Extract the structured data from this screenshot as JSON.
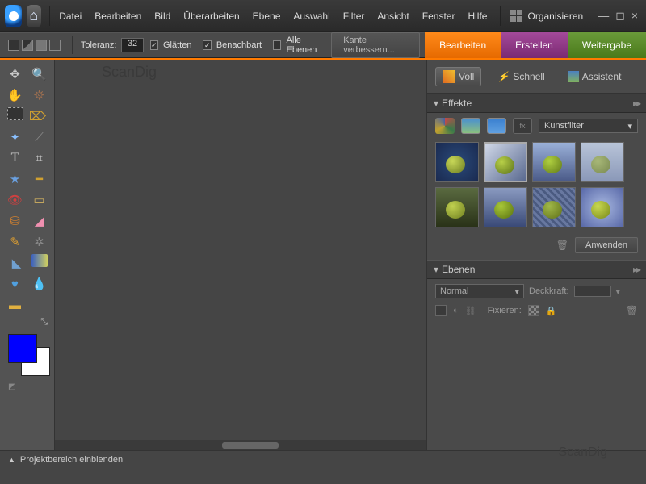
{
  "menus": [
    "Datei",
    "Bearbeiten",
    "Bild",
    "Überarbeiten",
    "Ebene",
    "Auswahl",
    "Filter",
    "Ansicht",
    "Fenster",
    "Hilfe"
  ],
  "organize": "Organisieren",
  "optbar": {
    "tol_label": "Toleranz:",
    "tol_value": "32",
    "cb1": "Glätten",
    "cb2": "Benachbart",
    "cb3": "Alle Ebenen",
    "refine": "Kante verbessern..."
  },
  "modes": {
    "edit": "Bearbeiten",
    "create": "Erstellen",
    "share": "Weitergabe"
  },
  "editModes": {
    "full": "Voll",
    "quick": "Schnell",
    "guided": "Assistent"
  },
  "panels": {
    "effects_title": "Effekte",
    "filter_label": "Kunstfilter",
    "apply": "Anwenden",
    "layers_title": "Ebenen",
    "blend": "Normal",
    "opacity_label": "Deckkraft:",
    "lock_label": "Fixieren:"
  },
  "status": {
    "project": "Projektbereich einblenden"
  },
  "watermark": "ScanDig",
  "swatch": {
    "fg": "#0000ff",
    "bg": "#ffffff"
  },
  "effect_thumbs": [
    {
      "bg": "radial-gradient(circle,#2a4a7a,#1a2a50)",
      "ball": "radial-gradient(circle at 35% 30%,#c8d858,#6a7a20)"
    },
    {
      "bg": "linear-gradient(135deg,#d0d8e8,#5a6a90)",
      "ball": "radial-gradient(circle at 35% 30%,#b8d048,#5a7018)"
    },
    {
      "bg": "linear-gradient(#9ab0d8,#4a5a88)",
      "ball": "radial-gradient(circle at 35% 30%,#b0d040,#607818)"
    },
    {
      "bg": "linear-gradient(#b8c4d8,#8a98b8)",
      "ball": "radial-gradient(circle at 35% 30%,#a8b878,#788850)"
    },
    {
      "bg": "linear-gradient(#5a6a40,#2a3218)",
      "ball": "radial-gradient(circle at 35% 30%,#c0d050,#708020)"
    },
    {
      "bg": "linear-gradient(#8a9ac0,#3a4a78)",
      "ball": "radial-gradient(circle at 35% 30%,#a8c838,#587010)"
    },
    {
      "bg": "repeating-linear-gradient(45deg,#6878a0 0 3px,#4a5a80 3px 6px)",
      "ball": "radial-gradient(circle at 35% 30%,#a0b848,#607018)"
    },
    {
      "bg": "radial-gradient(circle,#a8b8e0,#5868a8)",
      "ball": "radial-gradient(circle at 35% 30%,#c8d850,#788818)"
    }
  ]
}
